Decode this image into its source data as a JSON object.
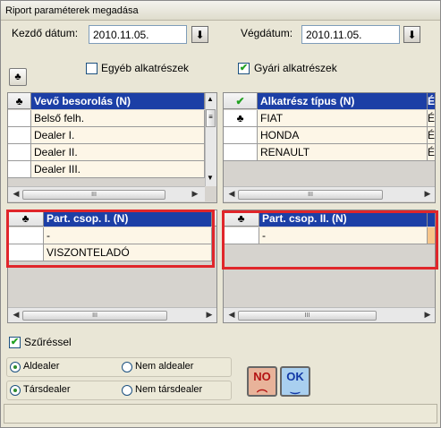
{
  "window": {
    "title": "Riport paraméterek megadása"
  },
  "dates": {
    "start_label": "Kezdő dátum:",
    "start_value": "2010.11.05.",
    "end_label": "Végdátum:",
    "end_value": "2010.11.05."
  },
  "options": {
    "club_icon": "club-icon",
    "egyeb_label": "Egyéb alkatrészek",
    "egyeb_checked": false,
    "gyari_label": "Gyári alkatrészek",
    "gyari_checked": true
  },
  "grid_vevo": {
    "header": "Vevő besorolás (N)",
    "rows": [
      "Belső felh.",
      "Dealer I.",
      "Dealer II.",
      "Dealer III."
    ]
  },
  "grid_alkatresz": {
    "header": "Alkatrész típus (N)",
    "extra_header": "É",
    "rows": [
      {
        "marker": "♣",
        "name": "FIAT",
        "extra": "É"
      },
      {
        "marker": "",
        "name": "HONDA",
        "extra": "É"
      },
      {
        "marker": "",
        "name": "RENAULT",
        "extra": "É"
      }
    ]
  },
  "grid_partcsop1": {
    "header": "Part. csop. I. (N)",
    "rows": [
      "-",
      "VISZONTELADÓ"
    ]
  },
  "grid_partcsop2": {
    "header": "Part. csop. II. (N)",
    "rows": [
      "-"
    ]
  },
  "scroll": {
    "thumb_grip": "III"
  },
  "filter": {
    "label": "Szűréssel",
    "checked": true
  },
  "radios": {
    "aldealer": "Aldealer",
    "nem_aldealer": "Nem aldealer",
    "tarsdealer": "Társdealer",
    "nem_tarsdealer": "Nem társdealer"
  },
  "buttons": {
    "no": "NO",
    "ok": "OK"
  },
  "colors": {
    "header_selected": "#1C3FA6",
    "row_bg": "#FDF6E7",
    "highlight": "#E0262B"
  }
}
